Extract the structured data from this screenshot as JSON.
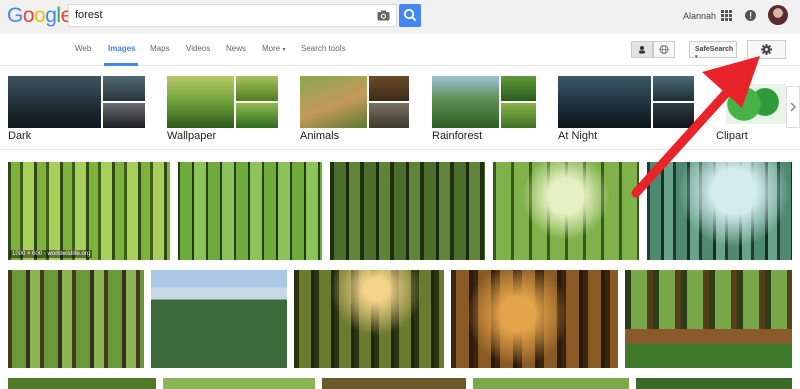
{
  "logo": {
    "letters": [
      "G",
      "o",
      "o",
      "g",
      "l",
      "e"
    ],
    "colors": [
      "#4285f4",
      "#ea4335",
      "#fbbc05",
      "#4285f4",
      "#34a853",
      "#ea4335"
    ]
  },
  "search": {
    "value": "forest"
  },
  "header": {
    "user_name": "Alannah"
  },
  "nav": {
    "tabs": [
      "Web",
      "Images",
      "Maps",
      "Videos",
      "News",
      "More",
      "Search tools"
    ],
    "active": "Images",
    "safesearch": "SafeSearch"
  },
  "related": [
    {
      "label": "Dark"
    },
    {
      "label": "Wallpaper"
    },
    {
      "label": "Animals"
    },
    {
      "label": "Rainforest"
    },
    {
      "label": "At Night"
    },
    {
      "label": "Clipart"
    }
  ],
  "results": {
    "first_caption": "1000 × 600 - worldwildlife.org"
  },
  "colors": {
    "accent": "#4285f4",
    "arrow": "#e8232a"
  }
}
